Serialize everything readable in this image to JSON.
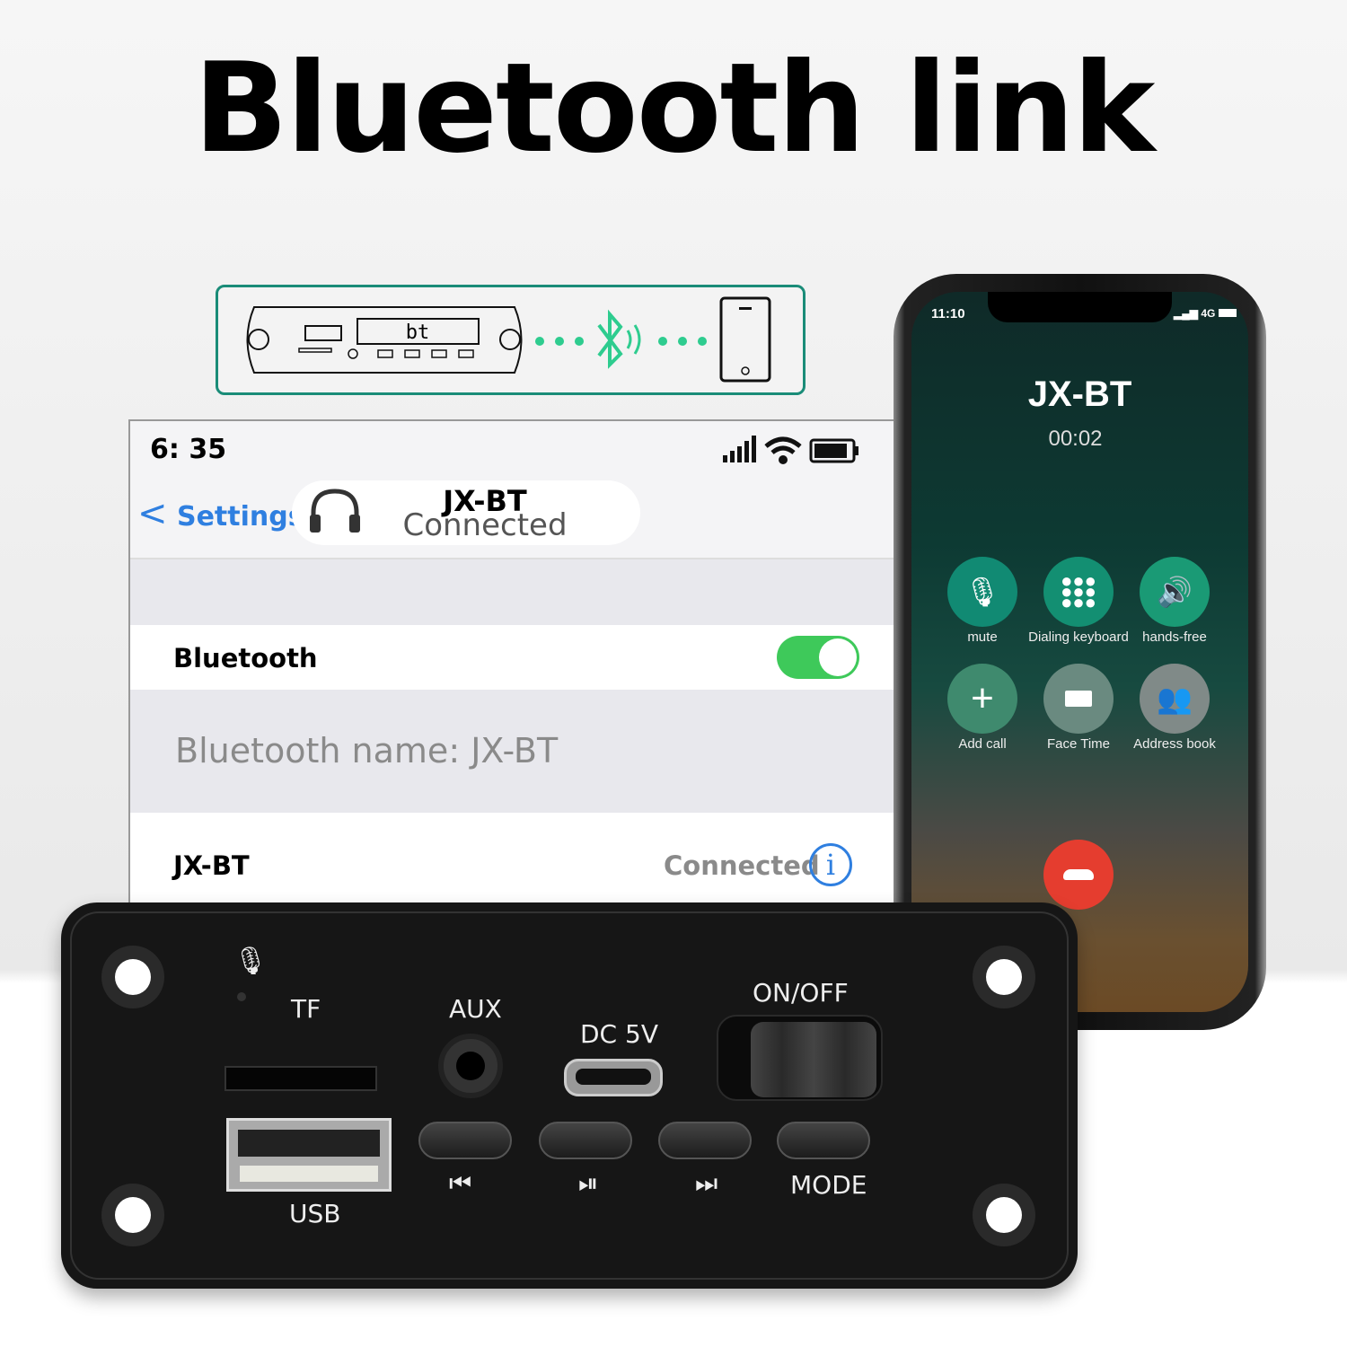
{
  "title": "Bluetooth link",
  "diagram": {
    "display_text": "bt",
    "accent": "#2ecc8f",
    "border": "#1a8c78"
  },
  "settings": {
    "status_time": "6: 35",
    "back_label": "Settings",
    "device_name": "JX-BT",
    "device_status": "Connected",
    "bluetooth_label": "Bluetooth",
    "bluetooth_on": true,
    "bluetooth_name": "Bluetooth name: JX-BT",
    "paired_device": "JX-BT",
    "paired_status": "Connected",
    "link_color": "#2f7fe0"
  },
  "phone": {
    "time": "11:10",
    "network": "4G",
    "caller": "JX-BT",
    "duration": "00:02",
    "buttons": [
      {
        "label": "mute",
        "icon": "mic-off-icon"
      },
      {
        "label": "Dialing keyboard",
        "icon": "keypad-icon"
      },
      {
        "label": "hands-free",
        "icon": "speaker-icon"
      },
      {
        "label": "Add call",
        "icon": "plus-icon"
      },
      {
        "label": "Face Time",
        "icon": "video-icon"
      },
      {
        "label": "Address book",
        "icon": "contacts-icon"
      }
    ],
    "end_call_color": "#e53d2f"
  },
  "board": {
    "tf": "TF",
    "aux": "AUX",
    "dc": "DC 5V",
    "onoff": "ON/OFF",
    "usb": "USB",
    "mode": "MODE",
    "prev": "⏮",
    "play": "⏯",
    "next": "⏭"
  }
}
